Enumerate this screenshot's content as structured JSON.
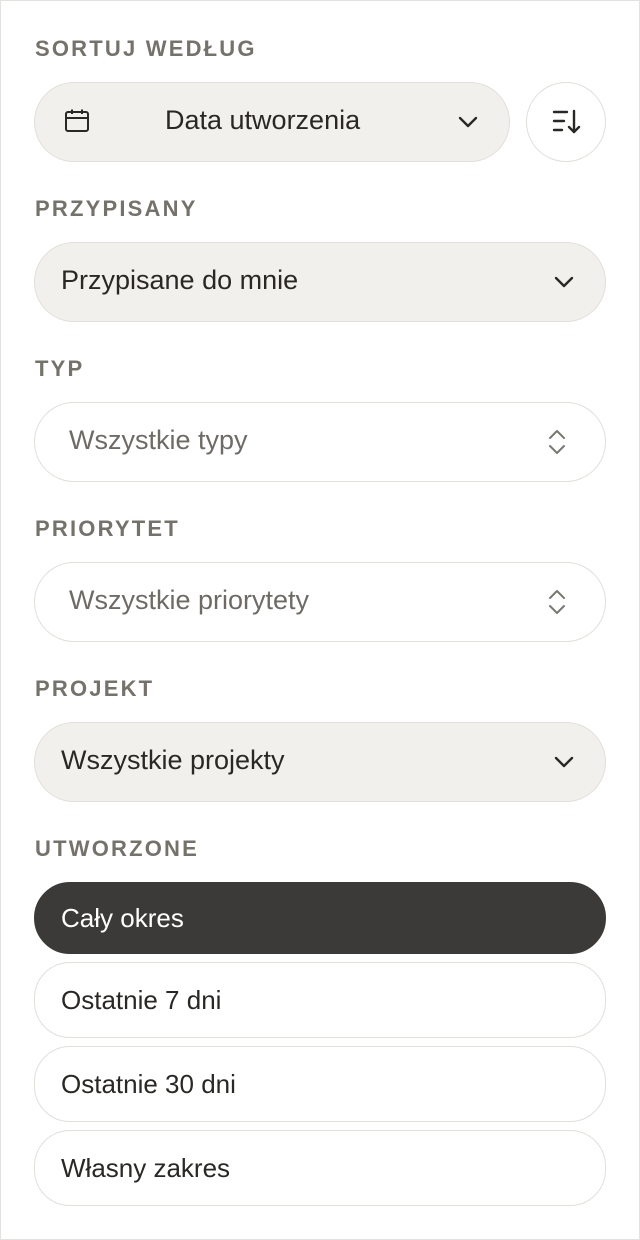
{
  "sort": {
    "label": "SORTUJ WEDŁUG",
    "value": "Data utworzenia",
    "icon": "calendar-icon",
    "direction_icon": "sort-descending-icon"
  },
  "assigned": {
    "label": "PRZYPISANY",
    "value": "Przypisane do mnie"
  },
  "type": {
    "label": "TYP",
    "placeholder": "Wszystkie typy"
  },
  "priority": {
    "label": "PRIORYTET",
    "placeholder": "Wszystkie priorytety"
  },
  "project": {
    "label": "PROJEKT",
    "value": "Wszystkie projekty"
  },
  "created": {
    "label": "UTWORZONE",
    "options": [
      {
        "label": "Cały okres",
        "selected": true
      },
      {
        "label": "Ostatnie 7 dni",
        "selected": false
      },
      {
        "label": "Ostatnie 30 dni",
        "selected": false
      },
      {
        "label": "Własny zakres",
        "selected": false
      }
    ]
  },
  "colors": {
    "selected_bg": "#3b3a38",
    "filled_bg": "#f2f0ed",
    "label": "#75726c"
  }
}
